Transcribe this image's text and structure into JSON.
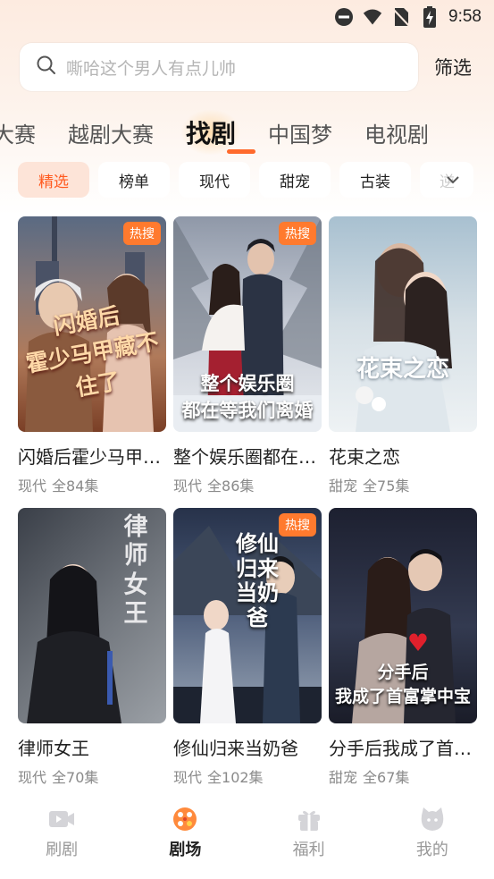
{
  "status_bar": {
    "time": "9:58"
  },
  "search": {
    "placeholder": "嘶哈这个男人有点儿帅",
    "filter_label": "筛选"
  },
  "category_tabs": [
    {
      "label": "大赛"
    },
    {
      "label": "越剧大赛"
    },
    {
      "label": "找剧",
      "active": true
    },
    {
      "label": "中国梦"
    },
    {
      "label": "电视剧"
    }
  ],
  "chips": [
    {
      "label": "精选",
      "active": true
    },
    {
      "label": "榜单"
    },
    {
      "label": "现代"
    },
    {
      "label": "甜宠"
    },
    {
      "label": "古装"
    },
    {
      "label": "逆"
    }
  ],
  "dramas": [
    {
      "title": "闪婚后霍少马甲…",
      "genre": "现代",
      "episodes": "全84集",
      "badge": "热搜",
      "poster_text": "闪婚后 霍少马甲藏不住了"
    },
    {
      "title": "整个娱乐圈都在…",
      "genre": "现代",
      "episodes": "全86集",
      "badge": "热搜",
      "poster_text": "整个娱乐圈 都在等我们离婚"
    },
    {
      "title": "花束之恋",
      "genre": "甜宠",
      "episodes": "全75集",
      "badge": "",
      "poster_text": "花束之恋"
    },
    {
      "title": "律师女王",
      "genre": "现代",
      "episodes": "全70集",
      "badge": "",
      "poster_text": "律师女王"
    },
    {
      "title": "修仙归来当奶爸",
      "genre": "现代",
      "episodes": "全102集",
      "badge": "热搜",
      "poster_text": "修仙归来当奶爸"
    },
    {
      "title": "分手后我成了首…",
      "genre": "甜宠",
      "episodes": "全67集",
      "badge": "",
      "poster_text": "分手后 我成了首富掌中宝"
    }
  ],
  "bottom_nav": [
    {
      "label": "刷剧",
      "icon": "video-icon"
    },
    {
      "label": "剧场",
      "icon": "theater-icon",
      "active": true
    },
    {
      "label": "福利",
      "icon": "gift-icon"
    },
    {
      "label": "我的",
      "icon": "profile-icon"
    }
  ],
  "colors": {
    "accent": "#ff5a1f",
    "badge": "#ff7a2e"
  }
}
